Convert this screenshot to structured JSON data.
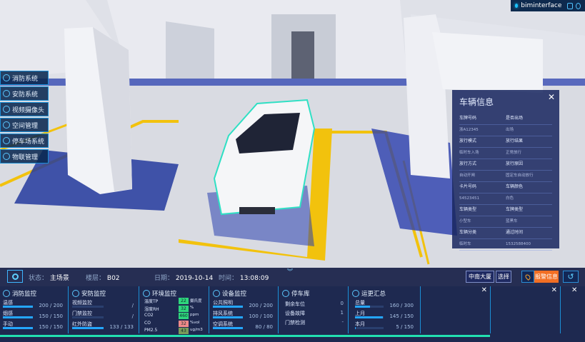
{
  "brand": {
    "name": "biminterface"
  },
  "menu": [
    {
      "label": "消防系统"
    },
    {
      "label": "安防系统"
    },
    {
      "label": "视频摄像头"
    },
    {
      "label": "空间管理"
    },
    {
      "label": "停车场系统"
    },
    {
      "label": "物联管理"
    }
  ],
  "vehicle_panel": {
    "title": "车辆信息",
    "rows": [
      {
        "a": "车牌号码",
        "b": "是否出场"
      },
      {
        "a": "浙A12345",
        "b": "出场"
      },
      {
        "a": "放行模式",
        "b": "放行结果"
      },
      {
        "a": "临时车入场",
        "b": "正常放行"
      },
      {
        "a": "放行方式",
        "b": "放行原因"
      },
      {
        "a": "自动开闸",
        "b": "固定车自动放行"
      },
      {
        "a": "卡片号码",
        "b": "车辆颜色"
      },
      {
        "a": "54523451",
        "b": "白色"
      },
      {
        "a": "车辆类型",
        "b": "车牌类型"
      },
      {
        "a": "小型车",
        "b": "蓝黑车"
      },
      {
        "a": "车辆分类",
        "b": "通过时间"
      },
      {
        "a": "临时车",
        "b": "1532588400"
      }
    ]
  },
  "status": {
    "state_label": "状态：",
    "state_value": "主场景",
    "floor_label": "楼层：",
    "floor_value": "B02",
    "date_label": "日期：",
    "date_value": "2019-10-14",
    "time_label": "时间：",
    "time_value": "13:08:09",
    "building_button": "中南大厦",
    "select_button": "选择",
    "alarm_button": "报警信息"
  },
  "fire": {
    "title": "消防监控",
    "rows": [
      {
        "label": "温感",
        "value": "200 / 200",
        "fill": 1.0
      },
      {
        "label": "烟感",
        "value": "150 / 150",
        "fill": 1.0
      },
      {
        "label": "手动",
        "value": "150 / 150",
        "fill": 1.0
      }
    ]
  },
  "security": {
    "title": "安防监控",
    "rows": [
      {
        "label": "视频监控",
        "value": "/",
        "fill": 0.0
      },
      {
        "label": "门禁监控",
        "value": "/",
        "fill": 0.0
      },
      {
        "label": "红外防盗",
        "value": "133 / 133",
        "fill": 1.0
      }
    ]
  },
  "environment": {
    "title": "环境监控",
    "rows": [
      {
        "label": "温度TP",
        "value": "22",
        "unit": "摄氏度",
        "color": "#2fd67d"
      },
      {
        "label": "湿度RH",
        "value": "32",
        "unit": "%",
        "color": "#2fd67d"
      },
      {
        "label": "CO2",
        "value": "460",
        "unit": "ppm",
        "color": "#2fd67d"
      },
      {
        "label": "CO",
        "value": "32",
        "unit": "%vol",
        "color": "#f08a8a"
      },
      {
        "label": "PM2.5",
        "value": "43",
        "unit": "ug/m3",
        "color": "#7a9b5a"
      }
    ]
  },
  "equipment": {
    "title": "设备监控",
    "rows": [
      {
        "label": "公共照明",
        "value": "200 / 200",
        "fill": 1.0
      },
      {
        "label": "排风系统",
        "value": "100 / 100",
        "fill": 1.0
      },
      {
        "label": "空调系统",
        "value": "80 / 80",
        "fill": 1.0
      }
    ]
  },
  "parking": {
    "title": "停车库",
    "rows": [
      {
        "label": "剩余车位",
        "value": "0"
      },
      {
        "label": "设备故障",
        "value": "1"
      },
      {
        "label": "门禁检测",
        "value": "-"
      }
    ]
  },
  "operation": {
    "title": "运更汇总",
    "rows": [
      {
        "label": "总量",
        "value": "160 / 300",
        "fill": 0.53
      },
      {
        "label": "上月",
        "value": "145 / 150",
        "fill": 0.97
      },
      {
        "label": "本月",
        "value": "5 / 150",
        "fill": 0.03
      }
    ]
  },
  "colors": {
    "accent": "#1b8fd6",
    "alarm": "#f26f24",
    "progress": "#22e0b0"
  }
}
